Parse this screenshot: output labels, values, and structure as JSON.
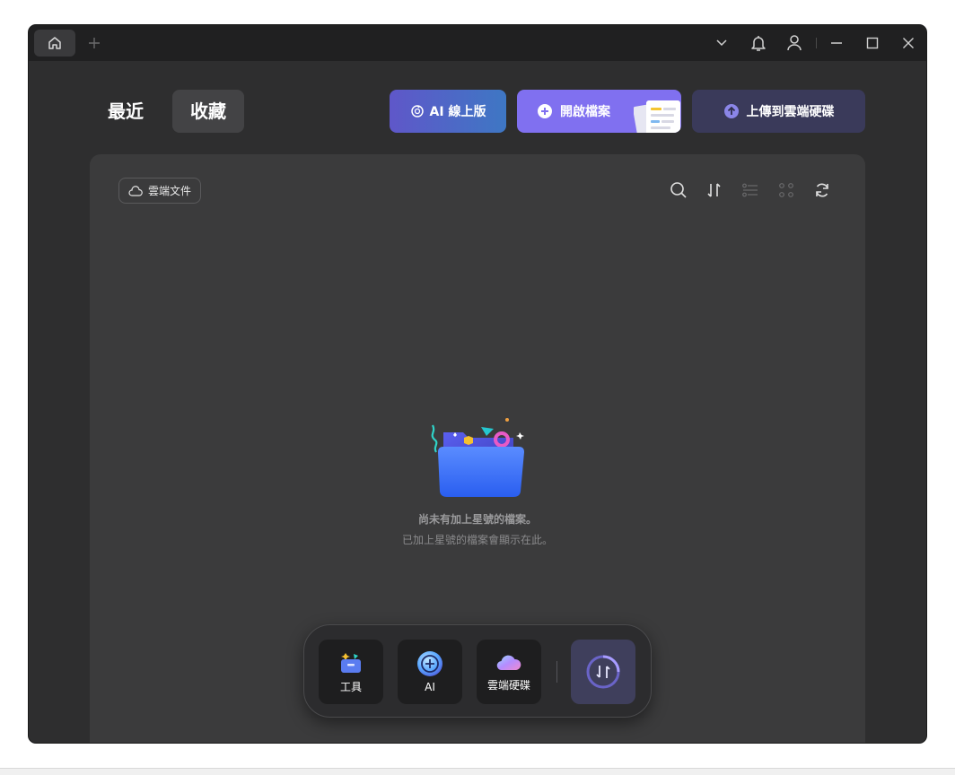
{
  "titlebar": {
    "home_tab_icon": "home-icon",
    "add_tab_icon": "plus-icon",
    "controls": [
      "chevron-down-icon",
      "bell-icon",
      "user-icon",
      "minimize-icon",
      "maximize-icon",
      "close-icon"
    ]
  },
  "tabs": {
    "recent": "最近",
    "favorites": "收藏",
    "active": "favorites"
  },
  "actions": {
    "ai_online": "AI 線上版",
    "open_file": "開啟檔案",
    "upload_cloud": "上傳到雲端硬碟"
  },
  "panel": {
    "cloud_docs": "雲端文件",
    "toolbar_icons": [
      "search-icon",
      "sort-icon",
      "list-view-icon",
      "grid-view-icon",
      "refresh-icon"
    ],
    "empty_title": "尚未有加上星號的檔案。",
    "empty_subtitle": "已加上星號的檔案會顯示在此。"
  },
  "dock": {
    "tools": "工具",
    "ai": "AI",
    "cloud_drive": "雲端硬碟",
    "convert_icon": "convert-icon"
  },
  "colors": {
    "window_bg": "#2e2e2f",
    "titlebar_bg": "#202021",
    "panel_bg": "#3b3b3c",
    "accent_purple": "#8070f0",
    "upload_bg": "#3a3a5a"
  }
}
